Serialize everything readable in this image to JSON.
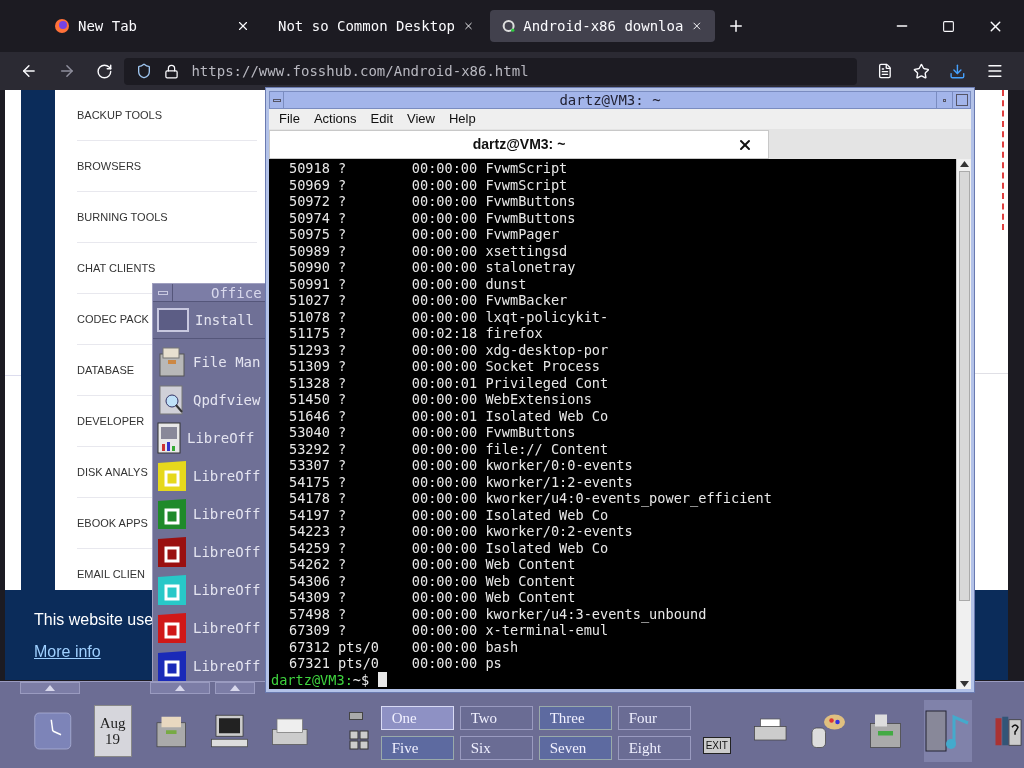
{
  "browser": {
    "tabs": [
      {
        "label": "New Tab",
        "selected": false
      },
      {
        "label": "Not so Common Desktop",
        "selected": false
      },
      {
        "label": "Android-x86 downloa",
        "selected": true
      }
    ],
    "url": "https://www.fosshub.com/Android-x86.html",
    "categories": [
      "BACKUP TOOLS",
      "BROWSERS",
      "BURNING TOOLS",
      "CHAT CLIENTS",
      "CODEC PACK",
      "DATABASE",
      "DEVELOPER",
      "DISK ANALYS",
      "EBOOK APPS",
      "EMAIL CLIEN"
    ],
    "cookie_banner": {
      "text": "This website use",
      "link": "More info"
    }
  },
  "office_menu": {
    "title": "Office",
    "items": [
      "Install",
      "File Man",
      "Qpdfview",
      "LibreOff",
      "LibreOff",
      "LibreOff",
      "LibreOff",
      "LibreOff",
      "LibreOff",
      "LibreOff"
    ]
  },
  "terminal": {
    "title": "dartz@VM3: ~",
    "menu": [
      "File",
      "Actions",
      "Edit",
      "View",
      "Help"
    ],
    "tab": "dartz@VM3: ~",
    "lines": [
      "50918 ?        00:00:00 FvwmScript",
      "50969 ?        00:00:00 FvwmScript",
      "50972 ?        00:00:00 FvwmButtons",
      "50974 ?        00:00:00 FvwmButtons",
      "50975 ?        00:00:00 FvwmPager",
      "50989 ?        00:00:00 xsettingsd",
      "50990 ?        00:00:00 stalonetray",
      "50991 ?        00:00:00 dunst",
      "51027 ?        00:00:00 FvwmBacker",
      "51078 ?        00:00:00 lxqt-policykit-",
      "51175 ?        00:02:18 firefox",
      "51293 ?        00:00:00 xdg-desktop-por",
      "51309 ?        00:00:00 Socket Process",
      "51328 ?        00:00:01 Privileged Cont",
      "51450 ?        00:00:00 WebExtensions",
      "51646 ?        00:00:01 Isolated Web Co",
      "53040 ?        00:00:00 FvwmButtons",
      "53292 ?        00:00:00 file:// Content",
      "53307 ?        00:00:00 kworker/0:0-events",
      "54175 ?        00:00:00 kworker/1:2-events",
      "54178 ?        00:00:00 kworker/u4:0-events_power_efficient",
      "54197 ?        00:00:00 Isolated Web Co",
      "54223 ?        00:00:00 kworker/0:2-events",
      "54259 ?        00:00:00 Isolated Web Co",
      "54262 ?        00:00:00 Web Content",
      "54306 ?        00:00:00 Web Content",
      "54309 ?        00:00:00 Web Content",
      "57498 ?        00:00:00 kworker/u4:3-events_unbound",
      "67309 ?        00:00:00 x-terminal-emul",
      "67312 pts/0    00:00:00 bash",
      "67321 pts/0    00:00:00 ps"
    ],
    "prompt": {
      "user": "dartz@VM3:",
      "path": "~$"
    }
  },
  "panel": {
    "date": {
      "month": "Aug",
      "day": "19"
    },
    "workspaces": [
      {
        "label": "One",
        "selected": true
      },
      {
        "label": "Two",
        "selected": false
      },
      {
        "label": "Three",
        "selected": false
      },
      {
        "label": "Four",
        "selected": false
      },
      {
        "label": "Five",
        "selected": false
      },
      {
        "label": "Six",
        "selected": false
      },
      {
        "label": "Seven",
        "selected": false
      },
      {
        "label": "Eight",
        "selected": false
      }
    ],
    "exit": "EXIT"
  }
}
